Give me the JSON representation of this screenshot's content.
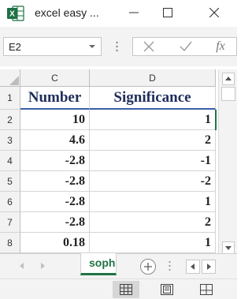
{
  "window": {
    "title": "excel easy ...",
    "minimize": "—",
    "maximize": "☐",
    "close": "✕"
  },
  "formula_bar": {
    "name_box": "E2",
    "cancel": "✕",
    "enter": "✓",
    "fx": "fx"
  },
  "grid": {
    "columns": [
      "C",
      "D"
    ],
    "rows": [
      {
        "num": "1",
        "c": "Number",
        "d": "Significance"
      },
      {
        "num": "2",
        "c": "10",
        "d": "1"
      },
      {
        "num": "3",
        "c": "4.6",
        "d": "2"
      },
      {
        "num": "4",
        "c": "-2.8",
        "d": "-1"
      },
      {
        "num": "5",
        "c": "-2.8",
        "d": "-2"
      },
      {
        "num": "6",
        "c": "-2.8",
        "d": "1"
      },
      {
        "num": "7",
        "c": "-2.8",
        "d": "2"
      },
      {
        "num": "8",
        "c": "0.18",
        "d": "1"
      }
    ],
    "active_cell": "E2"
  },
  "sheet_tabs": {
    "active_tab": "soph",
    "add": "+"
  },
  "colors": {
    "excel_green": "#1e7145",
    "header_text": "#1f2d5c"
  }
}
